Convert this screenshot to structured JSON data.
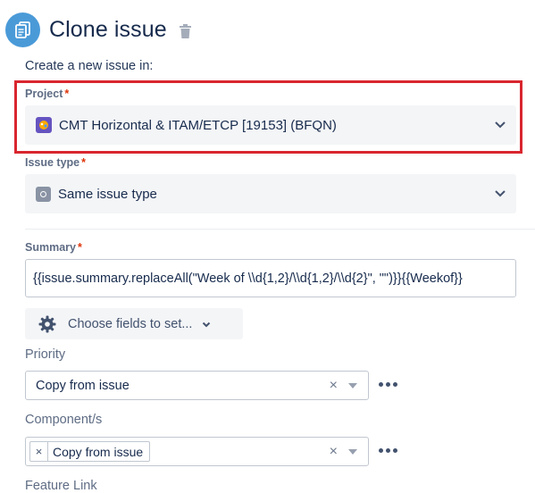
{
  "header": {
    "title": "Clone issue"
  },
  "intro": "Create a new issue in:",
  "project": {
    "label": "Project",
    "required_mark": "*",
    "value": "CMT Horizontal & ITAM/ETCP [19153] (BFQN)"
  },
  "issue_type": {
    "label": "Issue type",
    "required_mark": "*",
    "value": "Same issue type"
  },
  "summary": {
    "label": "Summary",
    "required_mark": "*",
    "value": "{{issue.summary.replaceAll(\"Week of \\\\d{1,2}/\\\\d{1,2}/\\\\d{2}\", \"\")}}{{Weekof}}"
  },
  "choose_fields": {
    "label": "Choose fields to set..."
  },
  "priority": {
    "label": "Priority",
    "value": "Copy from issue",
    "clear_glyph": "×"
  },
  "components": {
    "label": "Component/s",
    "chip_remove_glyph": "×",
    "chip_label": "Copy from issue",
    "clear_glyph": "×"
  },
  "next_field_label": "Feature Link",
  "colors": {
    "accent_icon_bg": "#4a9ad8",
    "highlight_border": "#d9262e",
    "required": "#de350b"
  },
  "icons": [
    "clone-issue-icon",
    "trash-icon",
    "project-avatar-icon",
    "issue-type-icon",
    "chevron-down-icon",
    "gear-icon",
    "more-icon"
  ]
}
